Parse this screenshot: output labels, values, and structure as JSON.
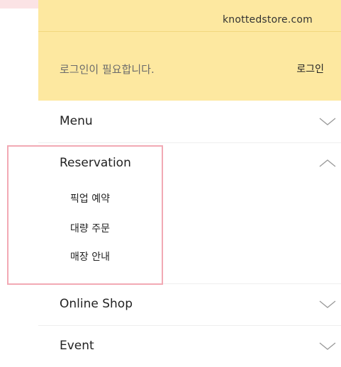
{
  "site": {
    "domain": "knottedstore.com"
  },
  "login": {
    "message": "로그인이 필요합니다.",
    "button_label": "로그인"
  },
  "menu": {
    "items": [
      {
        "label": "Menu",
        "state": "collapsed"
      },
      {
        "label": "Reservation",
        "state": "expanded",
        "sub_items": [
          "픽업 예약",
          "대량 주문",
          "매장 안내"
        ]
      },
      {
        "label": "Online Shop",
        "state": "collapsed"
      },
      {
        "label": "Event",
        "state": "collapsed"
      }
    ]
  },
  "colors": {
    "header_bg": "#fde8a0",
    "highlight": "#f2a9b4"
  },
  "icons": {
    "collapsed": "chevron-down-icon",
    "expanded": "chevron-up-icon"
  }
}
